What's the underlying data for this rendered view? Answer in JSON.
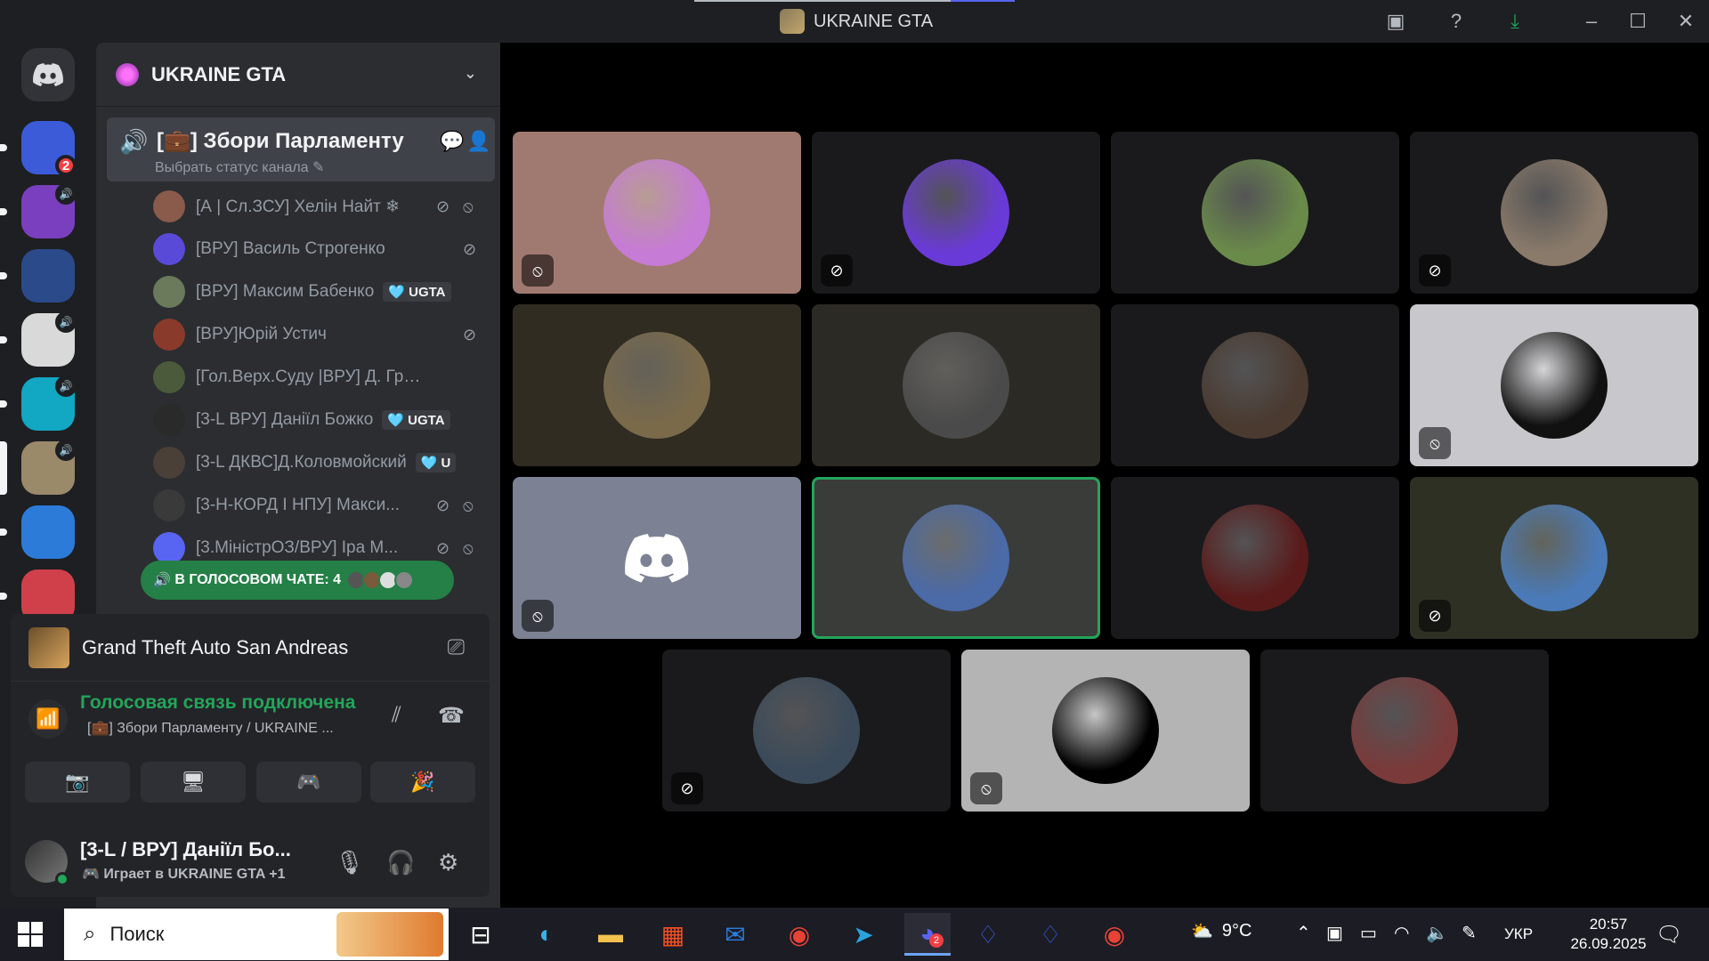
{
  "window": {
    "title": "UKRAINE GTA",
    "download_progress": 0.8
  },
  "guild": {
    "name": "UKRAINE GTA"
  },
  "channel": {
    "name": "[💼] Збори Парламенту",
    "status_placeholder": "Выбрать статус канала",
    "members": [
      {
        "name": "[А | Сл.ЗСУ] Хелін Найт ❄",
        "color": "#8a5a4a",
        "icons": [
          "mic-off-icon",
          "deafen-icon"
        ]
      },
      {
        "name": "[ВРУ] Василь Строгенко",
        "color": "#5a4ad8",
        "icons": [
          "mic-off-icon"
        ]
      },
      {
        "name": "[ВРУ] Максим Бабенко",
        "tag": "🩵 UGTA",
        "color": "#6a7a5a",
        "icons": []
      },
      {
        "name": "[ВРУ]Юрій Устич",
        "color": "#8a3a2a",
        "icons": [
          "mic-off-icon"
        ]
      },
      {
        "name": "[Гол.Верх.Суду |ВРУ] Д. Грицьков",
        "color": "#4a5a3a",
        "icons": []
      },
      {
        "name": "[3-L ВРУ] Даніїл Божко",
        "tag": "🩵 UGTA",
        "color": "#2a2a2a",
        "icons": []
      },
      {
        "name": "[3-L ДКВС]Д.Коловмойский",
        "tag": "🩵 U",
        "color": "#4a4038",
        "icons": []
      },
      {
        "name": "[3-Н-КОРД І НПУ] Макси...",
        "color": "#3a3a3a",
        "icons": [
          "mic-off-icon",
          "deafen-icon"
        ]
      },
      {
        "name": "[3.МіністрОЗ/ВРУ] Іра М...",
        "color": "#5865f2",
        "icons": [
          "mic-off-icon",
          "deafen-icon"
        ]
      }
    ],
    "voice_chat_label": "В ГОЛОСОВОМ ЧАТЕ: 4"
  },
  "servers": [
    {
      "name": "server-1",
      "color": "#3b5bd9",
      "badge": "2"
    },
    {
      "name": "server-2",
      "color": "#7a3fbf",
      "speaker": true
    },
    {
      "name": "server-3",
      "color": "#2a4a8a"
    },
    {
      "name": "server-4",
      "color": "#d9d9d9",
      "speaker": true
    },
    {
      "name": "server-5",
      "color": "#12a7c2",
      "speaker": true
    },
    {
      "name": "server-6",
      "color": "#9a8a6a",
      "speaker": true,
      "active": true
    },
    {
      "name": "server-7",
      "color": "#2c7bd8"
    },
    {
      "name": "server-8",
      "color": "#d0404a"
    }
  ],
  "activity": {
    "game": "Grand Theft Auto San Andreas"
  },
  "voice": {
    "title": "Голосовая связь подключена",
    "subtitle": "[💼] Збори Парламенту / UKRAINE ..."
  },
  "user": {
    "name": "[3-L / ВРУ] Даніїл Бо...",
    "status": "Играет в UKRAINE GTA +1"
  },
  "tiles": [
    {
      "bg": "#a07a70",
      "av": "#c67bd6",
      "mute": "camera-off-icon"
    },
    {
      "bg": "#1a1a1c",
      "av": "#6a3ad8",
      "mute": "mic-off-icon"
    },
    {
      "bg": "#1a1a1c",
      "av": "#6a8a4a"
    },
    {
      "bg": "#1a1a1c",
      "av": "#8a7a6a",
      "mute": "mic-off-icon"
    },
    {
      "bg": "#302c22",
      "av": "#7a6a4a"
    },
    {
      "bg": "#2c2a24",
      "av": "#4a4a4a"
    },
    {
      "bg": "#1a1a1c",
      "av": "#4a3a30"
    },
    {
      "bg": "#c8c8cc",
      "av": "#111111",
      "mute": "camera-off-icon"
    },
    {
      "bg": "#7c8293",
      "av": "#7c8293",
      "discord": true,
      "mute": "camera-off-icon"
    },
    {
      "bg": "#3a3c3a",
      "av": "#4a6aa8",
      "speaking": true
    },
    {
      "bg": "#1a1a1c",
      "av": "#5a1a1a"
    },
    {
      "bg": "#2e3024",
      "av": "#4a7ab8",
      "mute": "mic-off-icon"
    },
    {
      "bg": "#1a1a1c",
      "av": "#3a4a5a",
      "mute": "mic-off-icon"
    },
    {
      "bg": "#b4b4b4",
      "av": "#000000",
      "mute": "camera-off-icon"
    },
    {
      "bg": "#1a1a1c",
      "av": "#7a3a3a"
    }
  ],
  "taskbar": {
    "search_placeholder": "Поиск",
    "temperature": "9°C",
    "language": "УКР",
    "time": "20:57",
    "date": "26.09.2025",
    "discord_badge": "2"
  }
}
